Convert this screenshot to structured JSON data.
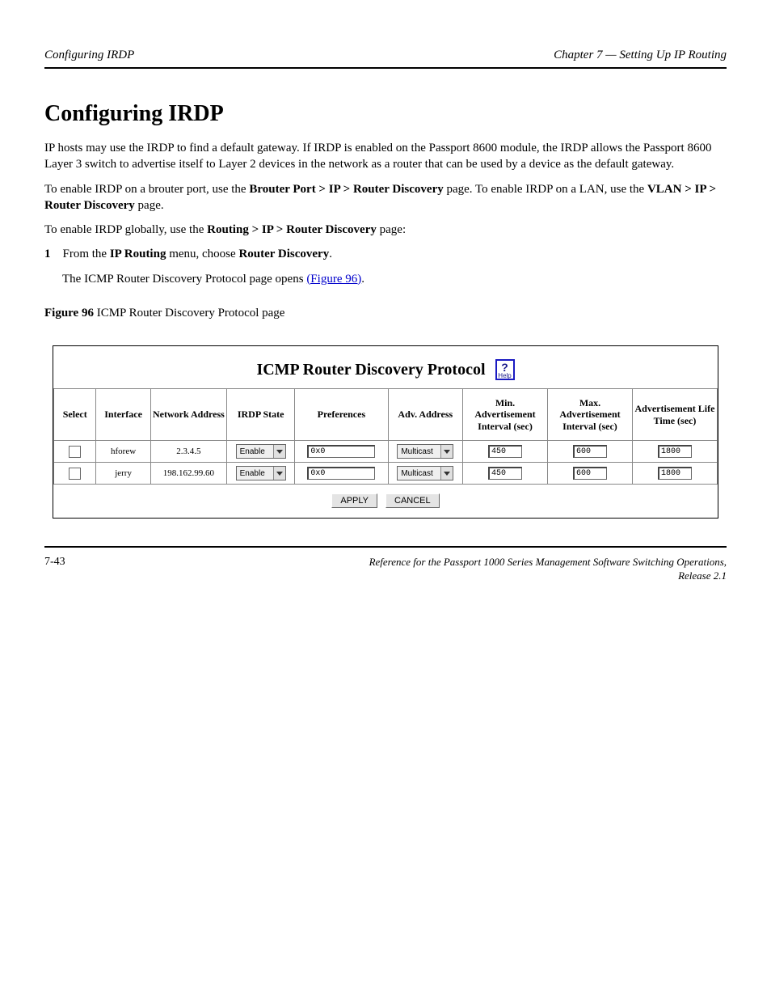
{
  "header": {
    "left": "Configuring IRDP",
    "right": "Chapter 7 — Setting Up IP Routing"
  },
  "section_title": "Configuring IRDP",
  "paragraphs": {
    "p1": "IP hosts may use the IRDP to find a default gateway. If IRDP is enabled on the Passport 8600 module, the IRDP allows the Passport 8600 Layer 3 switch to advertise itself to Layer 2 devices in the network as a router that can be used by a device as the default gateway.",
    "p2_plain": "To enable IRDP on a brouter port, use the ",
    "p2_bold": "Brouter Port > IP > Router Discovery",
    "p2_tail": " page. To enable IRDP on a LAN, use the ",
    "p2_bold2": "VLAN > IP > Router Discovery",
    "p2_tail2": " page.",
    "p3_lead": "To enable IRDP globally, use the ",
    "p3_bold": "Routing > IP > Router Discovery",
    "p3_tail": " page:",
    "step1_lead": "From the ",
    "step1_bold1": "IP Routing",
    "step1_mid": " menu, choose ",
    "step1_bold2": "Router Discovery",
    "step1_tail": ".",
    "step1_result_a": "The ICMP Router Discovery Protocol page opens ",
    "step1_result_link": "(Figure 96)",
    "step1_result_b": ".",
    "fig_label": "Figure 96   ",
    "fig_title": "ICMP Router Discovery Protocol page"
  },
  "list_marker": "1",
  "screenshot": {
    "title": "ICMP Router Discovery Protocol",
    "help_label": "Help",
    "columns": {
      "select": "Select",
      "iface": "Interface",
      "net": "Network Address",
      "irdp": "IRDP State",
      "pref": "Preferences",
      "addr": "Adv. Address",
      "min": "Min. Advertisement Interval (sec)",
      "max": "Max. Advertisement Interval (sec)",
      "life": "Advertisement Life Time (sec)"
    },
    "rows": [
      {
        "iface": "hforew",
        "net": "2.3.4.5",
        "irdp": "Enable",
        "pref": "0x0",
        "addr": "Multicast",
        "min": "450",
        "max": "600",
        "life": "1800"
      },
      {
        "iface": "jerry",
        "net": "198.162.99.60",
        "irdp": "Enable",
        "pref": "0x0",
        "addr": "Multicast",
        "min": "450",
        "max": "600",
        "life": "1800"
      }
    ],
    "buttons": {
      "apply": "APPLY",
      "cancel": "CANCEL"
    }
  },
  "footer": {
    "page": "7-43",
    "book_line1": "Reference for the Passport 1000 Series Management Software Switching Operations,",
    "book_line2": "Release 2.1"
  }
}
